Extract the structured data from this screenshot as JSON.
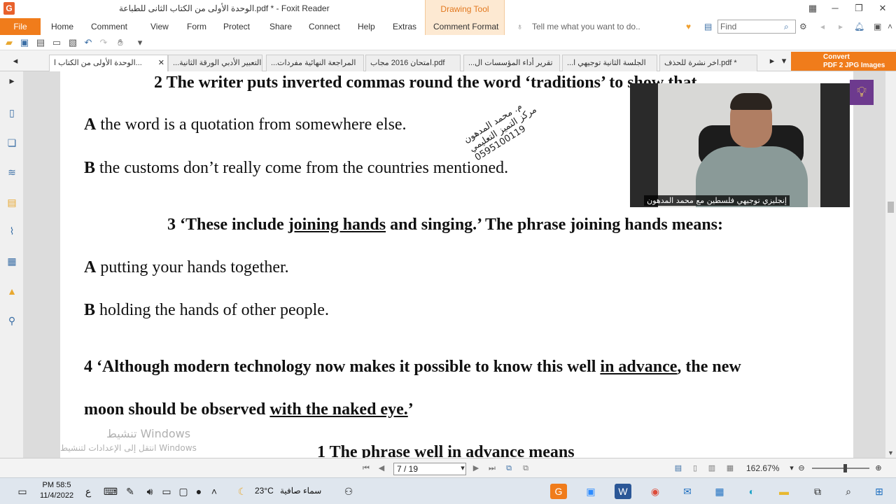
{
  "window": {
    "title": "الوحدة الأولى من الكتاب الثانى للطباعة.pdf * - Foxit Reader",
    "drawing_tool_label": "Drawing Tool"
  },
  "menu": {
    "file": "File",
    "items": [
      "Home",
      "Comment",
      "View",
      "Form",
      "Protect",
      "Share",
      "Connect",
      "Help",
      "Extras",
      "Comment Format"
    ],
    "tell_me": "Tell me what you want to do..",
    "find_placeholder": "Find"
  },
  "tabs": [
    {
      "label": "الوحدة الأولى من الكتاب ا...",
      "active": true
    },
    {
      "label": "...التعبير الأدبي الورقة الثانية",
      "active": false
    },
    {
      "label": "...المراجعة النهائية مفردات",
      "active": false
    },
    {
      "label": "امتحان 2016 مجاب.pdf",
      "active": false
    },
    {
      "label": "...تقرير أداء المؤسسات ال",
      "active": false
    },
    {
      "label": "...الجلسة الثانية توجيهي ا",
      "active": false
    },
    {
      "label": "اخر نشرة للحذف.pdf *",
      "active": false
    }
  ],
  "convert": {
    "line1": "Convert",
    "line2": "PDF 2 JPG Images"
  },
  "document": {
    "q2": "2 The writer puts inverted commas round the word ‘traditions’ to show that",
    "q2a_letter": "A",
    "q2a_text": " the word is a quotation from somewhere else.",
    "q2b_letter": "B",
    "q2b_text": " the customs don’t really come from the countries mentioned.",
    "q3_pre": "3 ‘These include ",
    "q3_u": "joining hands",
    "q3_post": " and singing.’ The phrase joining hands means:",
    "q3a_letter": "A",
    "q3a_text": " putting your hands together.",
    "q3b_letter": "B",
    "q3b_text": " holding the hands of other people.",
    "q4_pre": "4 ‘Although modern technology now makes it possible to know this  well ",
    "q4_u": "in advance",
    "q4_post": ", the new",
    "q4b_pre": "moon should be observed ",
    "q4b_u": "with the naked eye.",
    "q4b_post": "’",
    "q4_1": "1 The phrase well in advance means"
  },
  "stamp": {
    "line1": "م. محمد المدهون",
    "line2": "مركز التميز التعليمي",
    "line3": "0595100119"
  },
  "webcam": {
    "caption": "إنجليزي توجيهي فلسطين مع محمد المدهون"
  },
  "watermark": {
    "line1": "تنشيط Windows",
    "line2": "انتقل إلى الإعدادات لتنشيط Windows"
  },
  "status": {
    "page": "7 / 19",
    "zoom": "162.67%"
  },
  "taskbar": {
    "time": "PM 58:5",
    "date": "11/4/2022",
    "lang": "ع",
    "weather_temp": "23°C",
    "weather_text": "سماء صافية"
  },
  "colors": {
    "accent": "#f07c1b",
    "drawing_tool": "#e2781e",
    "bulb_bg": "#6d3a8e"
  }
}
